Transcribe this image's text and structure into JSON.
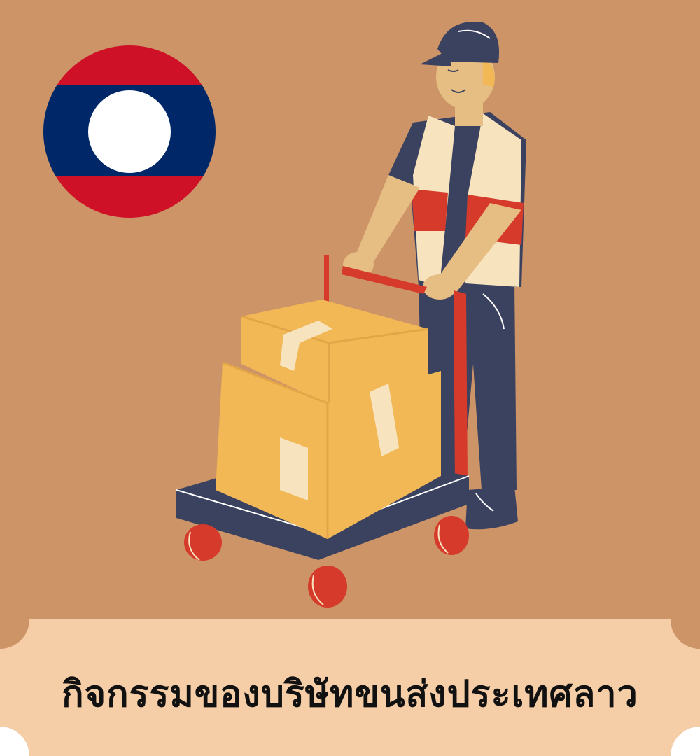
{
  "caption": "กิจกรรมของบริษัทขนส่งประเทศลาว",
  "illustration": {
    "subject": "delivery-worker-pushing-hand-truck",
    "flag": "laos-flag-icon"
  },
  "colors": {
    "background": "#cc9467",
    "caption_band": "#f5cda6",
    "flag_red": "#ce1126",
    "flag_blue": "#002868",
    "flag_white": "#ffffff",
    "navy": "#3b4260",
    "box": "#f2b855",
    "cart_red": "#d63a2a",
    "vest": "#f7e4bf",
    "skin": "#e6bd82"
  }
}
